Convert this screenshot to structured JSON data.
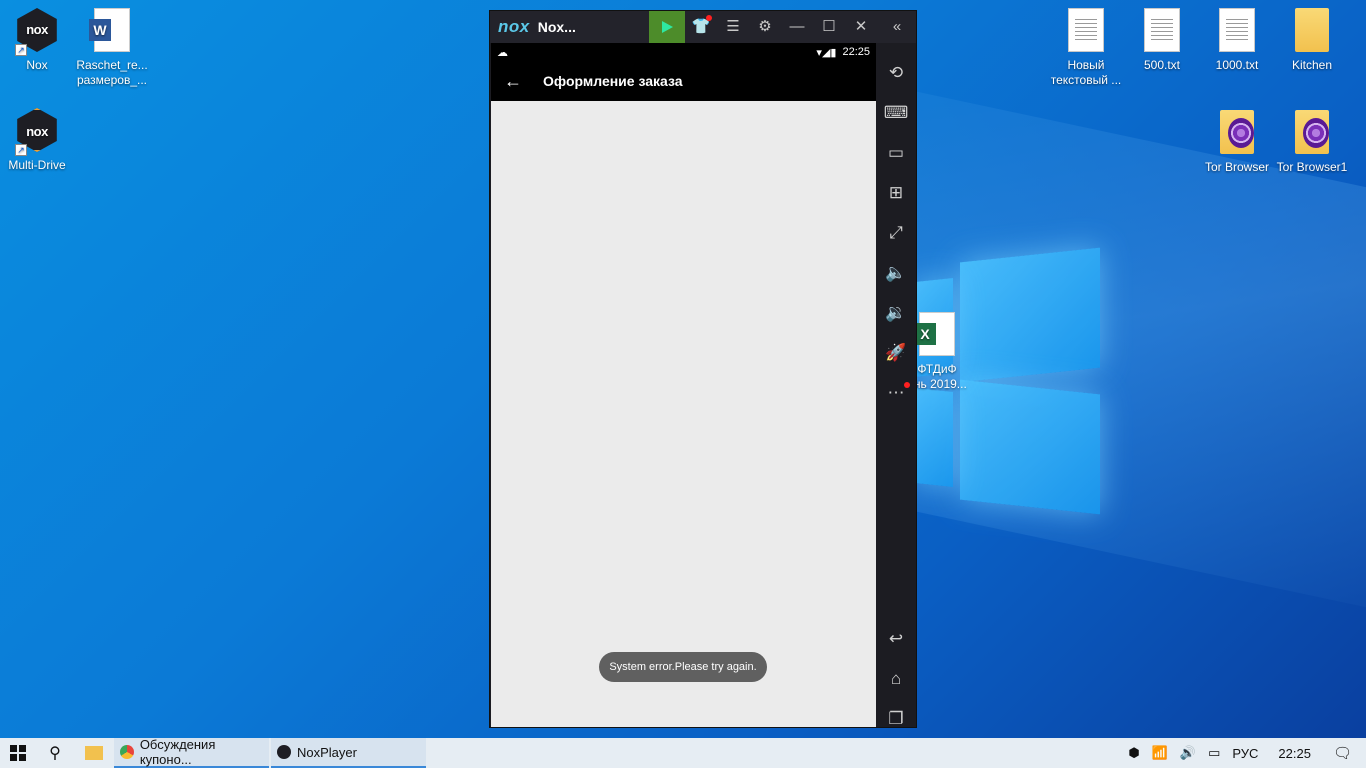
{
  "desktop": {
    "icons_left": [
      {
        "label": "Nox"
      },
      {
        "label": "Raschet_re... размеров_..."
      },
      {
        "label": "Multi-Drive"
      }
    ],
    "icons_right": [
      {
        "label": "Новый текстовый ..."
      },
      {
        "label": "500.txt"
      },
      {
        "label": "1000.txt"
      },
      {
        "label": "Kitchen"
      },
      {
        "label": "Tor Browser"
      },
      {
        "label": "Tor Browser1"
      }
    ],
    "excel_icon": {
      "line1": "ФТДиФ",
      "line2": "ень 2019..."
    }
  },
  "nox": {
    "logo": "nox",
    "title": "Nox...",
    "status_time": "22:25",
    "appbar_title": "Оформление заказа",
    "toast": "System error.Please try again."
  },
  "taskbar": {
    "apps": [
      {
        "label": "Обсуждения купоно...",
        "color": "#e8453c"
      },
      {
        "label": "NoxPlayer",
        "color": "#1e1e24"
      }
    ],
    "lang": "РУС",
    "time": "22:25"
  }
}
